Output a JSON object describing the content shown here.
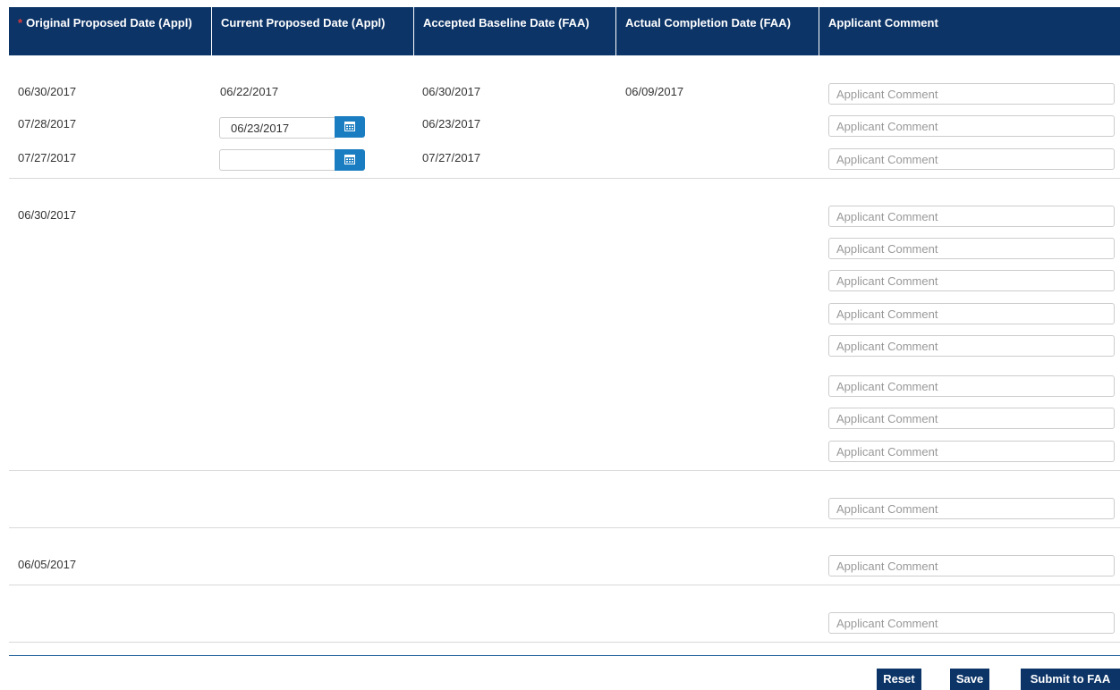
{
  "colors": {
    "header_bg": "#0c3467",
    "calendar_button": "#1a7dc1",
    "required_marker": "#e03a3a"
  },
  "header": {
    "required_marker": "*",
    "col1": "Original Proposed Date (Appl)",
    "col2": "Current Proposed Date (Appl)",
    "col3": "Accepted Baseline Date (FAA)",
    "col4": "Actual Completion Date (FAA)",
    "col5": "Applicant Comment"
  },
  "comment_placeholder": "Applicant Comment",
  "groups": [
    {
      "rows": [
        {
          "original": "06/30/2017",
          "current": "06/22/2017",
          "baseline": "06/30/2017",
          "actual": "06/09/2017",
          "comment": ""
        },
        {
          "original": "07/28/2017",
          "current_input": "06/23/2017",
          "baseline": "06/23/2017",
          "comment": ""
        },
        {
          "original": "07/27/2017",
          "current_input": "",
          "baseline": "07/27/2017",
          "comment": ""
        }
      ]
    },
    {
      "original": "06/30/2017",
      "comment_count": 8
    },
    {
      "original": "",
      "comment_count": 1
    },
    {
      "original": "06/05/2017",
      "comment_count": 1
    },
    {
      "original": "",
      "comment_count": 1
    }
  ],
  "icons": {
    "calendar": "calendar-icon"
  },
  "buttons": {
    "reset": "Reset",
    "save": "Save",
    "submit": "Submit to FAA"
  }
}
